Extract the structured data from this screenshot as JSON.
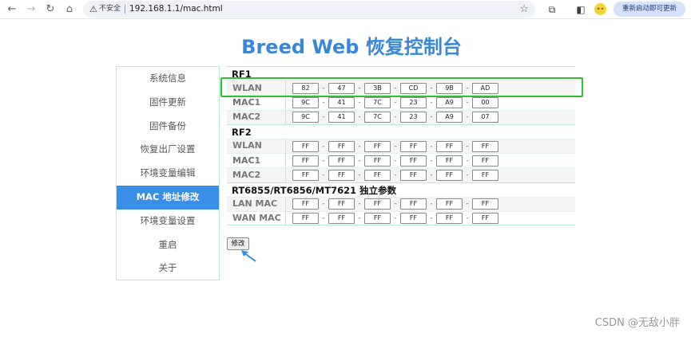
{
  "browser": {
    "security_label": "不安全",
    "url": "192.168.1.1/mac.html",
    "restart_label": "重新启动即可更新",
    "profile_icon": "profile-avatar-icon"
  },
  "page": {
    "title": "Breed Web 恢复控制台",
    "submit_label": "修改",
    "watermark": "CSDN @无敌小胖"
  },
  "sidebar": {
    "items": [
      {
        "label": "系统信息"
      },
      {
        "label": "固件更新"
      },
      {
        "label": "固件备份"
      },
      {
        "label": "恢复出厂设置"
      },
      {
        "label": "环境变量编辑"
      },
      {
        "label": "MAC 地址修改",
        "active": true
      },
      {
        "label": "环境变量设置"
      },
      {
        "label": "重启"
      },
      {
        "label": "关于"
      }
    ]
  },
  "sections": [
    {
      "title": "RF1",
      "rows": [
        {
          "label": "WLAN MAC",
          "octets": [
            "82",
            "47",
            "3B",
            "CD",
            "9B",
            "AD"
          ]
        },
        {
          "label": "MAC1",
          "octets": [
            "9C",
            "41",
            "7C",
            "23",
            "A9",
            "00"
          ]
        },
        {
          "label": "MAC2",
          "octets": [
            "9C",
            "41",
            "7C",
            "23",
            "A9",
            "07"
          ]
        }
      ]
    },
    {
      "title": "RF2",
      "rows": [
        {
          "label": "WLAN MAC",
          "octets": [
            "FF",
            "FF",
            "FF",
            "FF",
            "FF",
            "FF"
          ]
        },
        {
          "label": "MAC1",
          "octets": [
            "FF",
            "FF",
            "FF",
            "FF",
            "FF",
            "FF"
          ]
        },
        {
          "label": "MAC2",
          "octets": [
            "FF",
            "FF",
            "FF",
            "FF",
            "FF",
            "FF"
          ]
        }
      ]
    },
    {
      "title": "RT6855/RT6856/MT7621 独立参数",
      "rows": [
        {
          "label": "LAN MAC",
          "octets": [
            "FF",
            "FF",
            "FF",
            "FF",
            "FF",
            "FF"
          ]
        },
        {
          "label": "WAN MAC",
          "octets": [
            "FF",
            "FF",
            "FF",
            "FF",
            "FF",
            "FF"
          ]
        }
      ]
    }
  ],
  "colors": {
    "title": "#3a87d8",
    "active_menu": "#3a8ee6",
    "highlight_box": "#2ec12e",
    "arrow": "#3a8ee6"
  }
}
